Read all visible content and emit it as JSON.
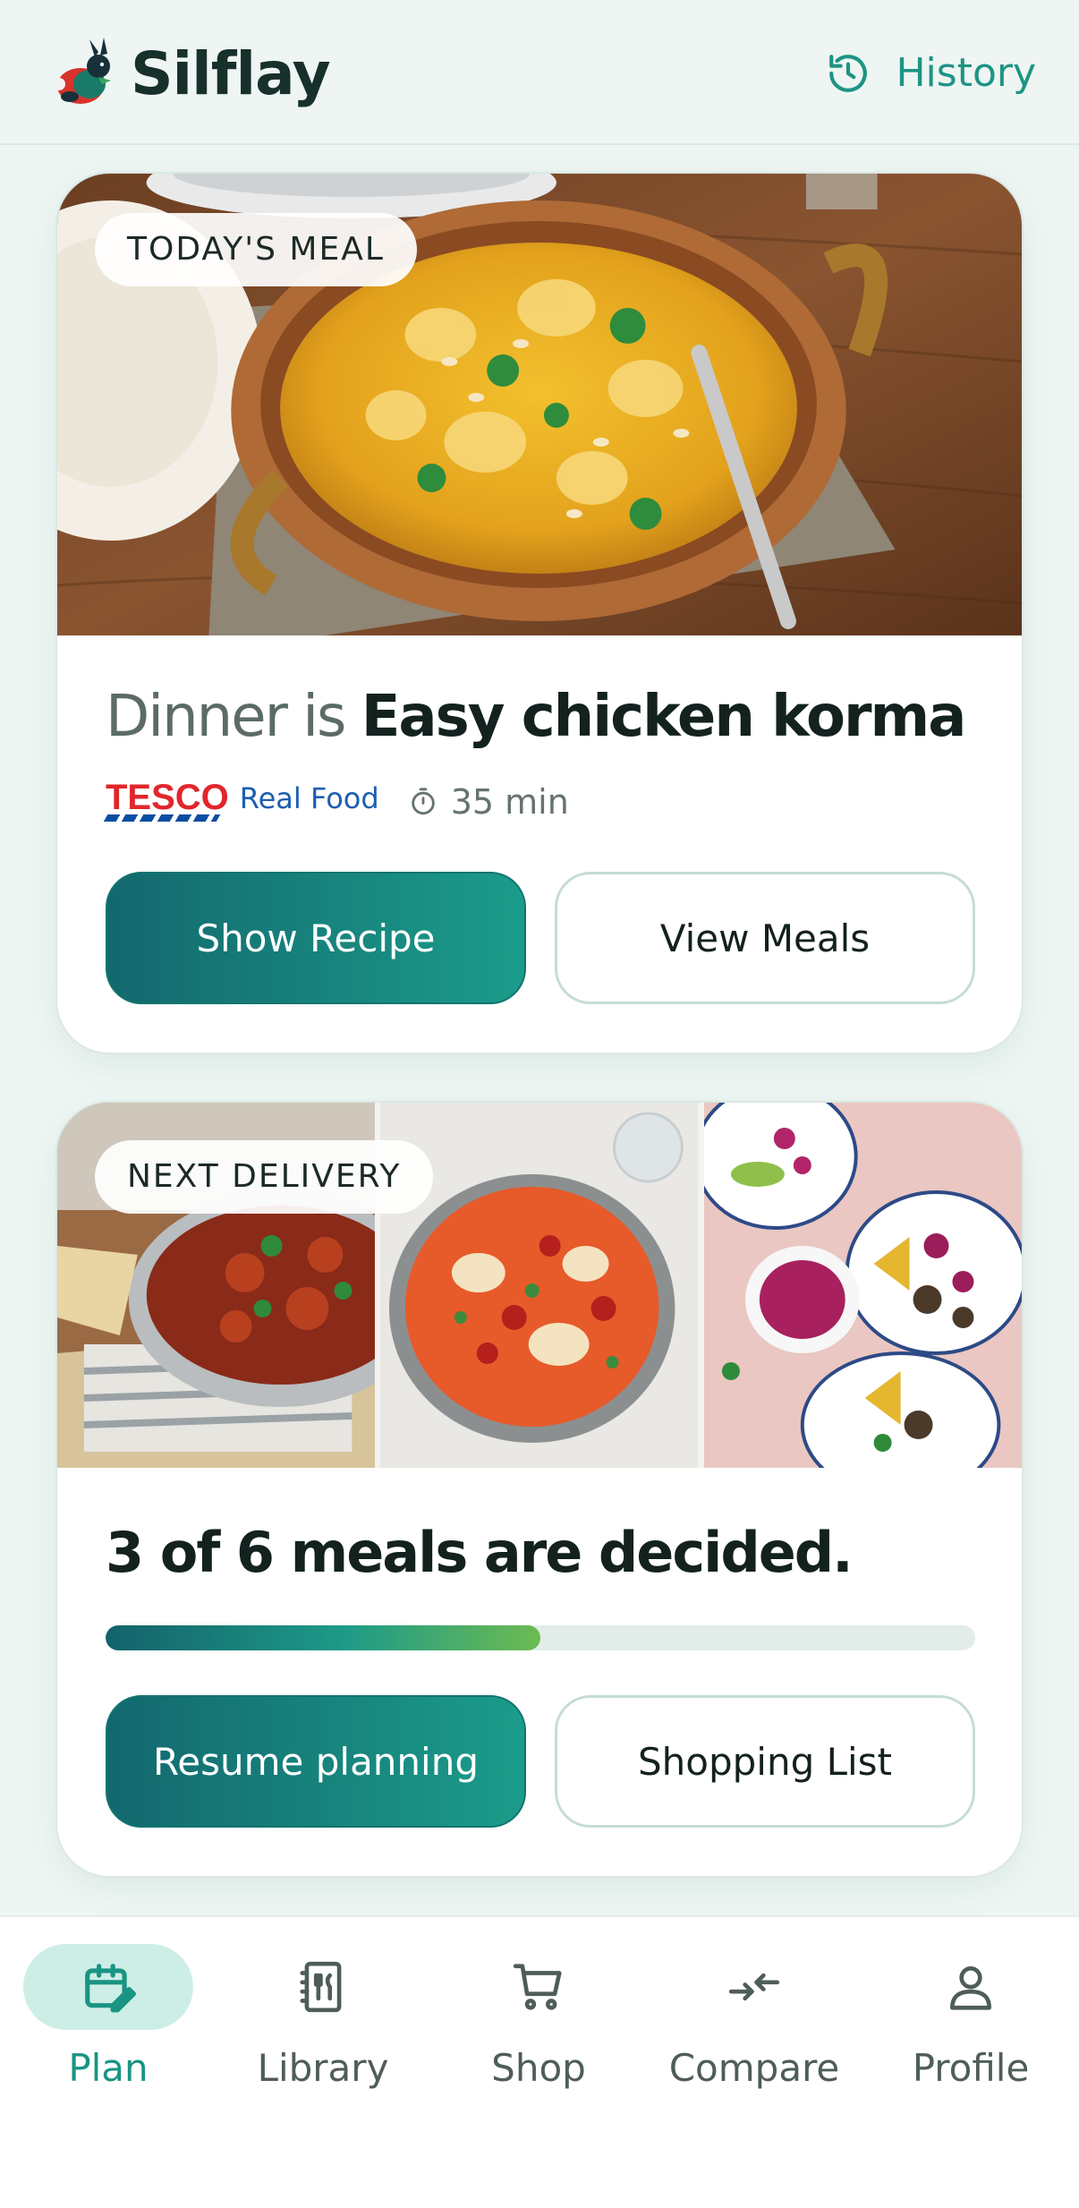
{
  "app": {
    "name": "Silflay",
    "history_label": "History"
  },
  "todays_meal": {
    "badge": "TODAY'S MEAL",
    "title_prefix": "Dinner is",
    "meal_name": "Easy chicken korma",
    "source_logo": "TESCO",
    "source_name": "Real Food",
    "duration": "35 min",
    "show_recipe_label": "Show Recipe",
    "view_meals_label": "View Meals"
  },
  "next_delivery": {
    "badge": "NEXT DELIVERY",
    "progress_text": "3 of 6 meals are decided.",
    "decided": 3,
    "total": 6,
    "progress_fraction": 0.5,
    "resume_label": "Resume planning",
    "shopping_list_label": "Shopping List"
  },
  "nav": {
    "items": [
      {
        "label": "Plan",
        "icon": "calendar-edit-icon",
        "active": true
      },
      {
        "label": "Library",
        "icon": "recipe-book-icon",
        "active": false
      },
      {
        "label": "Shop",
        "icon": "cart-icon",
        "active": false
      },
      {
        "label": "Compare",
        "icon": "compare-arrows-icon",
        "active": false
      },
      {
        "label": "Profile",
        "icon": "person-icon",
        "active": false
      }
    ]
  },
  "colors": {
    "accent": "#1a9483",
    "primary_gradient_start": "#13686e",
    "primary_gradient_end": "#1b9c8a",
    "background": "#eef6f3",
    "active_nav_bg": "#cdeee6"
  }
}
